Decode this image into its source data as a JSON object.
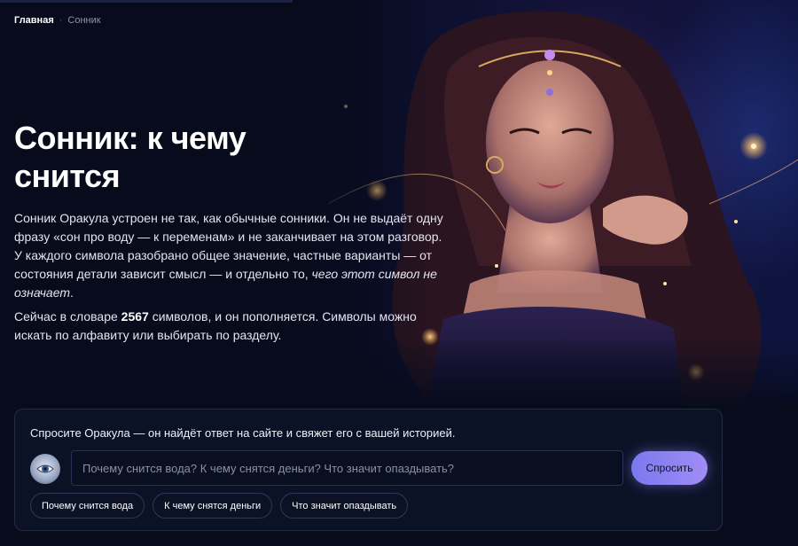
{
  "breadcrumb": {
    "home": "Главная",
    "separator": "·",
    "current": "Сонник"
  },
  "hero": {
    "title": "Сонник: к чему снится",
    "intro_main": "Сонник Оракула устроен не так, как обычные сонники. Он не выдаёт одну фразу «сон про воду — к переменам» и не заканчивает на этом разговор. У каждого символа разобрано общее значение, частные варианты — от состояния детали зависит смысл — и отдельно то, ",
    "intro_emphasis": "чего этот символ не означает",
    "intro_end": ".",
    "count_before": "Сейчас в словаре ",
    "count_value": "2567",
    "count_after": " символов, и он пополняется. Символы можно искать по алфавиту или выбирать по разделу."
  },
  "ask": {
    "heading": "Спросите Оракула — он найдёт ответ на сайте и свяжет его с вашей историей.",
    "placeholder": "Почему снится вода? К чему снятся деньги? Что значит опаздывать?",
    "button_label": "Спросить",
    "badge_icon": "oracle-eye-icon",
    "chips": [
      "Почему снится вода",
      "К чему снятся деньги",
      "Что значит опаздывать"
    ]
  },
  "colors": {
    "accent_start": "#7a79ee",
    "accent_end": "#a18cf6",
    "background": "#070b1c"
  }
}
